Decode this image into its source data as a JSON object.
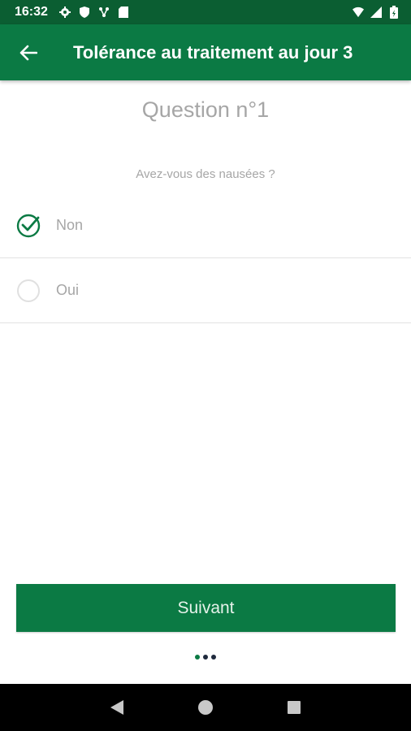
{
  "status_bar": {
    "time": "16:32",
    "left_icons": [
      "gear-icon",
      "shield-icon",
      "network-icon",
      "sd-card-icon"
    ],
    "right_icons": [
      "wifi-icon",
      "signal-icon",
      "battery-icon"
    ]
  },
  "app_bar": {
    "back_icon": "arrow-left-icon",
    "title": "Tolérance au traitement au jour 3"
  },
  "question": {
    "number_label": "Question n°1",
    "text": "Avez-vous des nausées ?"
  },
  "options": [
    {
      "label": "Non",
      "selected": true
    },
    {
      "label": "Oui",
      "selected": false
    }
  ],
  "next_button": {
    "label": "Suivant"
  },
  "pagination": {
    "total": 3,
    "current": 1
  },
  "colors": {
    "primary": "#0b7a44",
    "status_bar": "#0b5e32",
    "text_muted": "#a6a6a6",
    "divider": "#e2e2e2"
  },
  "nav_bar": {
    "buttons": [
      "back-triangle-icon",
      "home-circle-icon",
      "recents-square-icon"
    ]
  }
}
